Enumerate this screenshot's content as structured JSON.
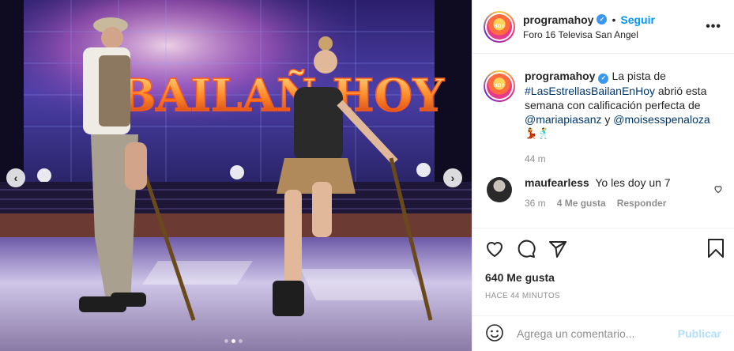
{
  "post": {
    "account": "programahoy",
    "follow_label": "Seguir",
    "separator": "•",
    "location": "Foro 16 Televisa San Angel",
    "more_label": "•••",
    "avatar_text": "HOY"
  },
  "media": {
    "stage_sign": "BAILAÑ HOY",
    "prev_label": "‹",
    "next_label": "›",
    "carousel_dots": 3,
    "active_dot": 1
  },
  "caption": {
    "author": "programahoy",
    "text_1": "La pista de ",
    "hashtag": "#LasEstrellasBailanEnHoy",
    "text_2": " abrió esta semana con calificación perfecta de ",
    "mention_1": "@mariapiasanz",
    "text_3": " y ",
    "mention_2": "@moisesspenaloza",
    "emojis": "💃🕺",
    "time": "44 m"
  },
  "comment": {
    "author": "maufearless",
    "text": "Yo les doy un 7",
    "time": "36 m",
    "likes": "4 Me gusta",
    "reply": "Responder"
  },
  "actions": {
    "likes_count": "640 Me gusta",
    "timestamp": "HACE 44 MINUTOS"
  },
  "composer": {
    "placeholder": "Agrega un comentario...",
    "publish": "Publicar"
  },
  "colors": {
    "link": "#00376b",
    "follow": "#0095f6",
    "muted": "#8e8e8e",
    "publish_disabled": "#b2dffc"
  }
}
